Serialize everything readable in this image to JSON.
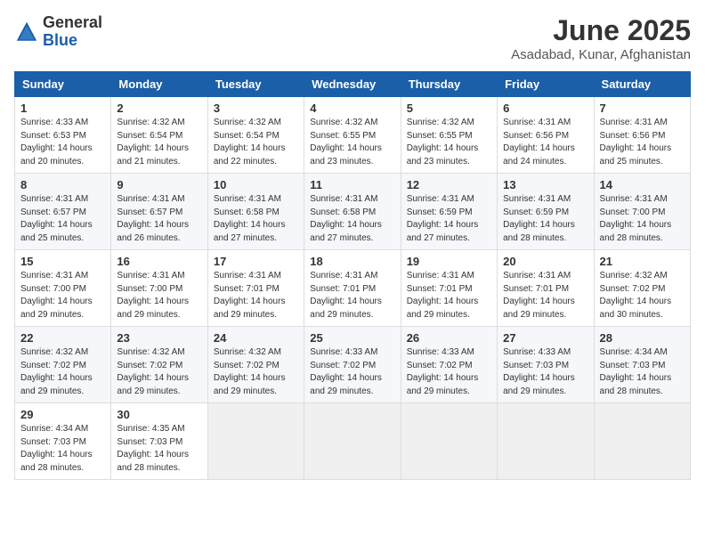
{
  "logo": {
    "general": "General",
    "blue": "Blue"
  },
  "title": {
    "month_year": "June 2025",
    "location": "Asadabad, Kunar, Afghanistan"
  },
  "days_of_week": [
    "Sunday",
    "Monday",
    "Tuesday",
    "Wednesday",
    "Thursday",
    "Friday",
    "Saturday"
  ],
  "weeks": [
    [
      {
        "day": "1",
        "sunrise": "4:33 AM",
        "sunset": "6:53 PM",
        "daylight": "14 hours and 20 minutes."
      },
      {
        "day": "2",
        "sunrise": "4:32 AM",
        "sunset": "6:54 PM",
        "daylight": "14 hours and 21 minutes."
      },
      {
        "day": "3",
        "sunrise": "4:32 AM",
        "sunset": "6:54 PM",
        "daylight": "14 hours and 22 minutes."
      },
      {
        "day": "4",
        "sunrise": "4:32 AM",
        "sunset": "6:55 PM",
        "daylight": "14 hours and 23 minutes."
      },
      {
        "day": "5",
        "sunrise": "4:32 AM",
        "sunset": "6:55 PM",
        "daylight": "14 hours and 23 minutes."
      },
      {
        "day": "6",
        "sunrise": "4:31 AM",
        "sunset": "6:56 PM",
        "daylight": "14 hours and 24 minutes."
      },
      {
        "day": "7",
        "sunrise": "4:31 AM",
        "sunset": "6:56 PM",
        "daylight": "14 hours and 25 minutes."
      }
    ],
    [
      {
        "day": "8",
        "sunrise": "4:31 AM",
        "sunset": "6:57 PM",
        "daylight": "14 hours and 25 minutes."
      },
      {
        "day": "9",
        "sunrise": "4:31 AM",
        "sunset": "6:57 PM",
        "daylight": "14 hours and 26 minutes."
      },
      {
        "day": "10",
        "sunrise": "4:31 AM",
        "sunset": "6:58 PM",
        "daylight": "14 hours and 27 minutes."
      },
      {
        "day": "11",
        "sunrise": "4:31 AM",
        "sunset": "6:58 PM",
        "daylight": "14 hours and 27 minutes."
      },
      {
        "day": "12",
        "sunrise": "4:31 AM",
        "sunset": "6:59 PM",
        "daylight": "14 hours and 27 minutes."
      },
      {
        "day": "13",
        "sunrise": "4:31 AM",
        "sunset": "6:59 PM",
        "daylight": "14 hours and 28 minutes."
      },
      {
        "day": "14",
        "sunrise": "4:31 AM",
        "sunset": "7:00 PM",
        "daylight": "14 hours and 28 minutes."
      }
    ],
    [
      {
        "day": "15",
        "sunrise": "4:31 AM",
        "sunset": "7:00 PM",
        "daylight": "14 hours and 29 minutes."
      },
      {
        "day": "16",
        "sunrise": "4:31 AM",
        "sunset": "7:00 PM",
        "daylight": "14 hours and 29 minutes."
      },
      {
        "day": "17",
        "sunrise": "4:31 AM",
        "sunset": "7:01 PM",
        "daylight": "14 hours and 29 minutes."
      },
      {
        "day": "18",
        "sunrise": "4:31 AM",
        "sunset": "7:01 PM",
        "daylight": "14 hours and 29 minutes."
      },
      {
        "day": "19",
        "sunrise": "4:31 AM",
        "sunset": "7:01 PM",
        "daylight": "14 hours and 29 minutes."
      },
      {
        "day": "20",
        "sunrise": "4:31 AM",
        "sunset": "7:01 PM",
        "daylight": "14 hours and 29 minutes."
      },
      {
        "day": "21",
        "sunrise": "4:32 AM",
        "sunset": "7:02 PM",
        "daylight": "14 hours and 30 minutes."
      }
    ],
    [
      {
        "day": "22",
        "sunrise": "4:32 AM",
        "sunset": "7:02 PM",
        "daylight": "14 hours and 29 minutes."
      },
      {
        "day": "23",
        "sunrise": "4:32 AM",
        "sunset": "7:02 PM",
        "daylight": "14 hours and 29 minutes."
      },
      {
        "day": "24",
        "sunrise": "4:32 AM",
        "sunset": "7:02 PM",
        "daylight": "14 hours and 29 minutes."
      },
      {
        "day": "25",
        "sunrise": "4:33 AM",
        "sunset": "7:02 PM",
        "daylight": "14 hours and 29 minutes."
      },
      {
        "day": "26",
        "sunrise": "4:33 AM",
        "sunset": "7:02 PM",
        "daylight": "14 hours and 29 minutes."
      },
      {
        "day": "27",
        "sunrise": "4:33 AM",
        "sunset": "7:03 PM",
        "daylight": "14 hours and 29 minutes."
      },
      {
        "day": "28",
        "sunrise": "4:34 AM",
        "sunset": "7:03 PM",
        "daylight": "14 hours and 28 minutes."
      }
    ],
    [
      {
        "day": "29",
        "sunrise": "4:34 AM",
        "sunset": "7:03 PM",
        "daylight": "14 hours and 28 minutes."
      },
      {
        "day": "30",
        "sunrise": "4:35 AM",
        "sunset": "7:03 PM",
        "daylight": "14 hours and 28 minutes."
      },
      null,
      null,
      null,
      null,
      null
    ]
  ]
}
